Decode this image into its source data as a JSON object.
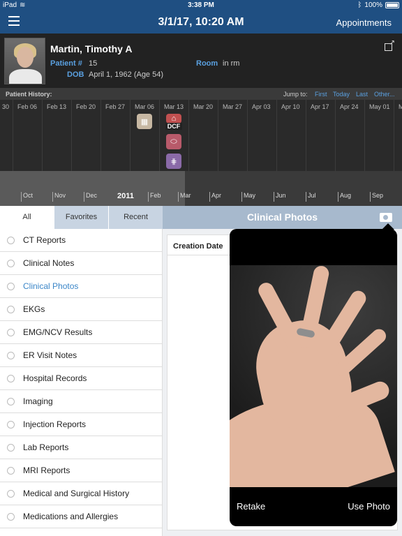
{
  "status": {
    "device": "iPad",
    "time": "3:38 PM",
    "battery": "100%"
  },
  "nav": {
    "title": "3/1/17, 10:20 AM",
    "appointments": "Appointments",
    "menu_icon": "hamburger-icon"
  },
  "patient": {
    "name": "Martin, Timothy A",
    "patient_label": "Patient #",
    "patient_number": "15",
    "room_label": "Room",
    "room_value": "in rm",
    "dob_label": "DOB",
    "dob_value": "April 1, 1962 (Age 54)"
  },
  "history": {
    "label": "Patient History:",
    "jump_to": "Jump to:",
    "first": "First",
    "today": "Today",
    "last": "Last",
    "other": "Other...",
    "dates": [
      "30",
      "Feb 06",
      "Feb 13",
      "Feb 20",
      "Feb 27",
      "Mar 06",
      "Mar 13",
      "Mar 20",
      "Mar 27",
      "Apr 03",
      "Apr 10",
      "Apr 17",
      "Apr 24",
      "May 01",
      "M"
    ],
    "event_dcf": "DCF",
    "months": [
      "Oct",
      "Nov",
      "Dec",
      "Feb",
      "Mar",
      "Apr",
      "May",
      "Jun",
      "Jul",
      "Aug",
      "Sep"
    ],
    "year": "2011"
  },
  "tabs": [
    "All",
    "Favorites",
    "Recent"
  ],
  "categories": [
    "CT Reports",
    "Clinical Notes",
    "Clinical Photos",
    "EKGs",
    "EMG/NCV Results",
    "ER Visit Notes",
    "Hospital Records",
    "Imaging",
    "Injection Reports",
    "Lab Reports",
    "MRI Reports",
    "Medical and Surgical History",
    "Medications and Allergies"
  ],
  "selected_category": "Clinical Photos",
  "content": {
    "title": "Clinical Photos",
    "column": "Creation Date"
  },
  "camera": {
    "retake": "Retake",
    "use_photo": "Use Photo"
  },
  "colors": {
    "navbar": "#1f4f82",
    "accent": "#3b86c8",
    "tab_bg": "#c8d4e2",
    "content_header": "#a7b9cd"
  }
}
